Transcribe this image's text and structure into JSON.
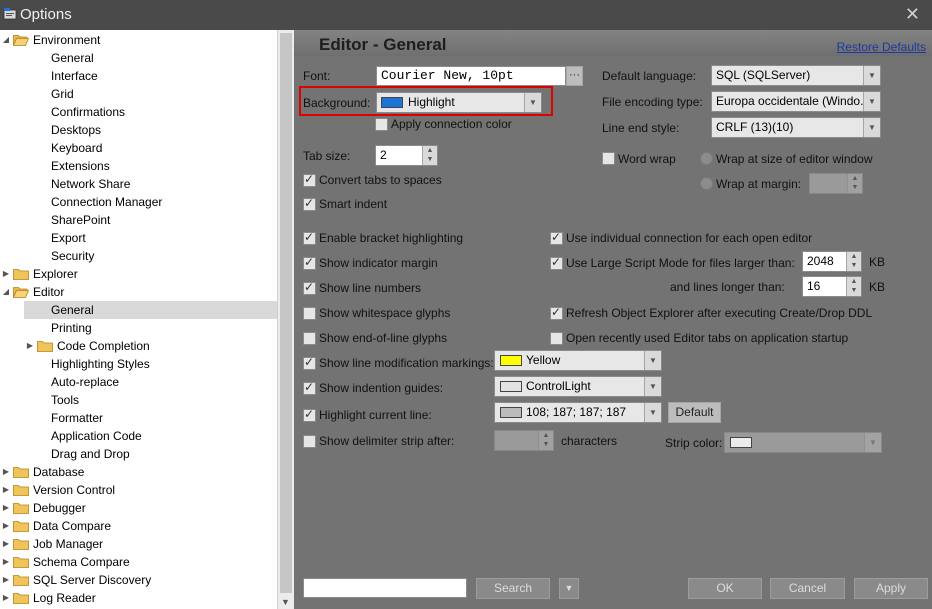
{
  "window": {
    "title": "Options",
    "close_glyph": "✕"
  },
  "sidebar": {
    "items": [
      {
        "label": "Environment",
        "level": 0,
        "expanded": true,
        "folder": true
      },
      {
        "label": "General",
        "level": 1
      },
      {
        "label": "Interface",
        "level": 1
      },
      {
        "label": "Grid",
        "level": 1
      },
      {
        "label": "Confirmations",
        "level": 1
      },
      {
        "label": "Desktops",
        "level": 1
      },
      {
        "label": "Keyboard",
        "level": 1
      },
      {
        "label": "Extensions",
        "level": 1
      },
      {
        "label": "Network Share",
        "level": 1
      },
      {
        "label": "Connection Manager",
        "level": 1
      },
      {
        "label": "SharePoint",
        "level": 1
      },
      {
        "label": "Export",
        "level": 1
      },
      {
        "label": "Security",
        "level": 1
      },
      {
        "label": "Explorer",
        "level": 0,
        "expanded": false,
        "folder": true
      },
      {
        "label": "Editor",
        "level": 0,
        "expanded": true,
        "folder": true
      },
      {
        "label": "General",
        "level": 1,
        "selected": true
      },
      {
        "label": "Printing",
        "level": 1
      },
      {
        "label": "Code Completion",
        "level": 1,
        "expanded": false,
        "folder": true
      },
      {
        "label": "Highlighting Styles",
        "level": 1
      },
      {
        "label": "Auto-replace",
        "level": 1
      },
      {
        "label": "Tools",
        "level": 1
      },
      {
        "label": "Formatter",
        "level": 1
      },
      {
        "label": "Application Code",
        "level": 1
      },
      {
        "label": "Drag and Drop",
        "level": 1
      },
      {
        "label": "Database",
        "level": 0,
        "expanded": false,
        "folder": true
      },
      {
        "label": "Version Control",
        "level": 0,
        "expanded": false,
        "folder": true
      },
      {
        "label": "Debugger",
        "level": 0,
        "expanded": false,
        "folder": true
      },
      {
        "label": "Data Compare",
        "level": 0,
        "expanded": false,
        "folder": true
      },
      {
        "label": "Job Manager",
        "level": 0,
        "expanded": false,
        "folder": true
      },
      {
        "label": "Schema Compare",
        "level": 0,
        "expanded": false,
        "folder": true
      },
      {
        "label": "SQL Server Discovery",
        "level": 0,
        "expanded": false,
        "folder": true
      },
      {
        "label": "Log Reader",
        "level": 0,
        "expanded": false,
        "folder": true
      }
    ]
  },
  "content": {
    "title": "Editor - General",
    "restore_defaults": "Restore Defaults",
    "font": {
      "label": "Font:",
      "value": "Courier New, 10pt",
      "browse": "···"
    },
    "background": {
      "label": "Background:",
      "value": "Highlight",
      "color": "#1e73d6"
    },
    "apply_connection_color": {
      "label": "Apply connection color",
      "checked": false
    },
    "tab_size": {
      "label": "Tab size:",
      "value": "2"
    },
    "convert_tabs": {
      "label": "Convert tabs to spaces",
      "checked": true
    },
    "smart_indent": {
      "label": "Smart indent",
      "checked": true
    },
    "default_language": {
      "label": "Default language:",
      "value": "SQL (SQLServer)"
    },
    "file_encoding": {
      "label": "File encoding type:",
      "value": "Europa occidentale (Windo..."
    },
    "line_end": {
      "label": "Line end style:",
      "value": "CRLF (13)(10)"
    },
    "word_wrap": {
      "label": "Word wrap",
      "checked": false
    },
    "wrap_window": {
      "label": "Wrap at size of editor window"
    },
    "wrap_margin": {
      "label": "Wrap at margin:"
    },
    "left_options": [
      {
        "label": "Enable bracket highlighting",
        "checked": true
      },
      {
        "label": "Show indicator margin",
        "checked": true
      },
      {
        "label": "Show line numbers",
        "checked": true
      },
      {
        "label": "Show whitespace glyphs",
        "checked": false
      },
      {
        "label": "Show end-of-line glyphs",
        "checked": false
      },
      {
        "label": "Show line modification markings:",
        "checked": true
      },
      {
        "label": "Show indention guides:",
        "checked": true
      },
      {
        "label": "Highlight current line:",
        "checked": true
      },
      {
        "label": "Show delimiter strip after:",
        "checked": false
      }
    ],
    "right_options": [
      {
        "label": "Use individual connection for each open editor",
        "checked": true
      },
      {
        "label": "Use Large Script Mode for files larger than:",
        "checked": true
      },
      {
        "label": "Refresh Object Explorer after executing Create/Drop DDL",
        "checked": true
      },
      {
        "label": "Open recently used Editor tabs on application startup",
        "checked": false
      }
    ],
    "large_script_kb": {
      "value": "2048",
      "unit": "KB"
    },
    "lines_longer": {
      "label": "and lines longer than:",
      "value": "16",
      "unit": "KB"
    },
    "modification_color": {
      "value": "Yellow",
      "color": "#ffff00"
    },
    "indention_color": {
      "value": "ControlLight",
      "color": "#e3e3e3"
    },
    "current_line_color": {
      "value": "108; 187; 187; 187",
      "color": "#bbbbbb",
      "default_button": "Default"
    },
    "delimiter": {
      "unit": "characters",
      "strip_color_label": "Strip color:",
      "strip_color": "#ececec"
    }
  },
  "footer": {
    "search_placeholder": "",
    "search_button": "Search",
    "ok": "OK",
    "cancel": "Cancel",
    "apply": "Apply"
  }
}
